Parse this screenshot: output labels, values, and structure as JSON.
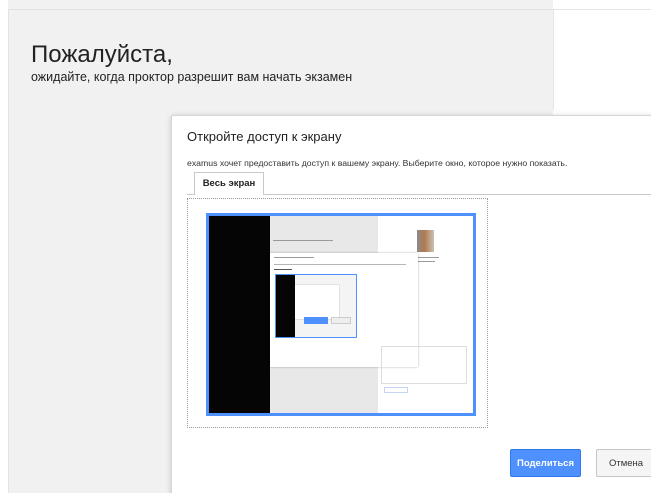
{
  "page": {
    "title_line1": "Пожалуйста,",
    "title_line2": "ожидайте, когда проктор разрешит вам начать экзамен"
  },
  "dialog": {
    "title": "Откройте доступ к экрану",
    "description": "examus хочет предоставить доступ к вашему экрану. Выберите окно, которое нужно показать.",
    "tabs": [
      {
        "label": "Весь экран",
        "selected": true
      }
    ],
    "share_button": "Поделиться",
    "cancel_button": "Отмена"
  },
  "colors": {
    "accent": "#4d90fe",
    "page_background": "#f1f1f1"
  }
}
